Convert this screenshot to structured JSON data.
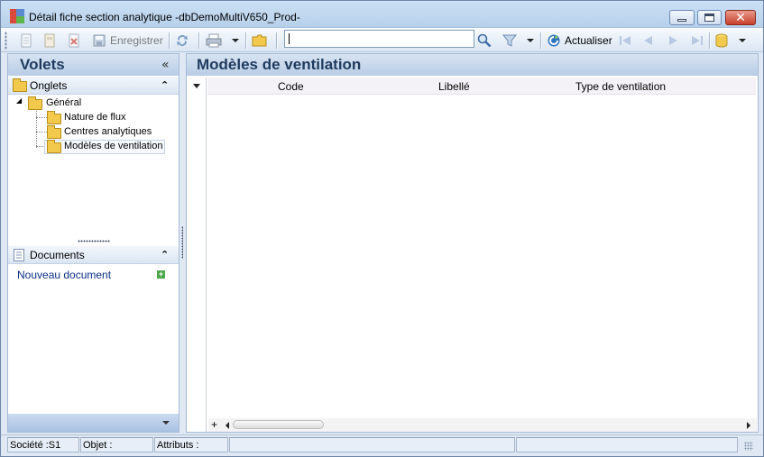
{
  "window": {
    "title": "Détail fiche section analytique -dbDemoMultiV650_Prod-"
  },
  "toolbar": {
    "save_label": "Enregistrer",
    "refresh_label": "Actualiser",
    "search_value": ""
  },
  "left_panel": {
    "title": "Volets",
    "collapse_glyph": "«",
    "tabs_section": {
      "title": "Onglets",
      "toggle": "⌃",
      "tree": {
        "root": "Général",
        "children": [
          "Nature de flux",
          "Centres analytiques",
          "Modèles de ventilation"
        ],
        "selected": "Modèles de ventilation"
      }
    },
    "documents_section": {
      "title": "Documents",
      "toggle": "⌃",
      "new_document_link": "Nouveau document"
    }
  },
  "main": {
    "title": "Modèles de ventilation",
    "grid": {
      "columns": [
        "Code",
        "Libellé",
        "Type de ventilation"
      ],
      "rows": []
    },
    "add_row_glyph": "+"
  },
  "status_bar": {
    "company": "Société :S1",
    "object": "Objet :",
    "attributes": "Attributs :"
  }
}
